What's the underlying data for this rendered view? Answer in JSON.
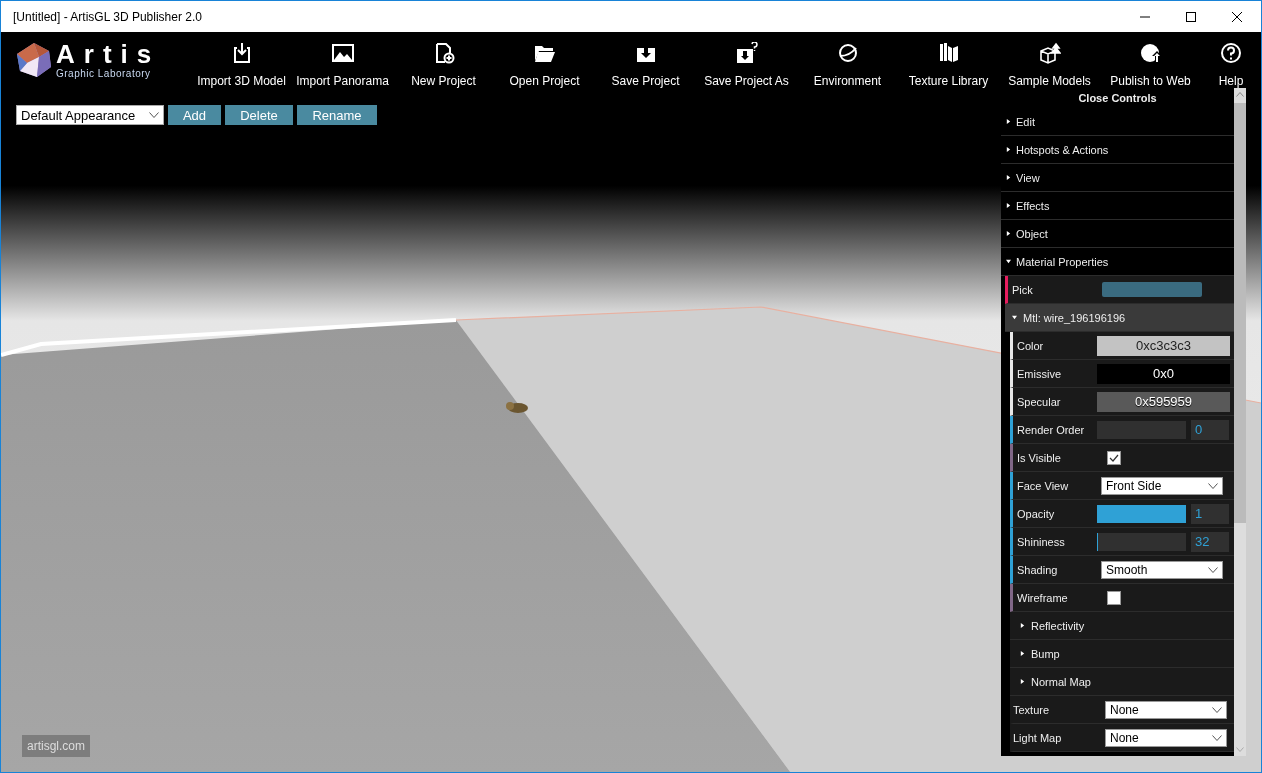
{
  "window": {
    "title": "[Untitled] - ArtisGL 3D Publisher 2.0"
  },
  "logo": {
    "name": "Artis",
    "subtitle": "Graphic Laboratory"
  },
  "toolbar": {
    "items": [
      {
        "label": "Import 3D Model"
      },
      {
        "label": "Import Panorama"
      },
      {
        "label": "New Project"
      },
      {
        "label": "Open Project"
      },
      {
        "label": "Save Project"
      },
      {
        "label": "Save Project As"
      },
      {
        "label": "Environment"
      },
      {
        "label": "Texture Library"
      },
      {
        "label": "Sample Models"
      },
      {
        "label": "Publish to Web"
      },
      {
        "label": "Help"
      }
    ]
  },
  "appearance": {
    "value": "Default Appearance",
    "buttons": [
      "Add",
      "Delete",
      "Rename"
    ]
  },
  "viewport": {
    "watermark": "artisgl.com"
  },
  "panel": {
    "close_label": "Close Controls",
    "sections": [
      {
        "label": "Edit",
        "expanded": false
      },
      {
        "label": "Hotspots & Actions",
        "expanded": false
      },
      {
        "label": "View",
        "expanded": false
      },
      {
        "label": "Effects",
        "expanded": false
      },
      {
        "label": "Object",
        "expanded": false
      },
      {
        "label": "Material Properties",
        "expanded": true
      }
    ],
    "rows": [
      {
        "kind": "pick",
        "label": "Pick"
      },
      {
        "kind": "folder",
        "label": "Mtl: wire_196196196",
        "expanded": true
      },
      {
        "kind": "color",
        "label": "Color",
        "value": "0xc3c3c3",
        "color": "#c3c3c3"
      },
      {
        "kind": "color",
        "label": "Emissive",
        "value": "0x0",
        "color": "#000000"
      },
      {
        "kind": "color",
        "label": "Specular",
        "value": "0x595959",
        "color": "#595959"
      },
      {
        "kind": "number",
        "label": "Render Order",
        "value": "0"
      },
      {
        "kind": "checkbox",
        "label": "Is Visible",
        "checked": true
      },
      {
        "kind": "select",
        "label": "Face View",
        "value": "Front Side"
      },
      {
        "kind": "slider",
        "label": "Opacity",
        "value": "1",
        "level": 1
      },
      {
        "kind": "slider",
        "label": "Shininess",
        "value": "32",
        "level": 0.01
      },
      {
        "kind": "select",
        "label": "Shading",
        "value": "Smooth"
      },
      {
        "kind": "checkbox",
        "label": "Wireframe",
        "checked": false
      },
      {
        "kind": "subfolder",
        "label": "Reflectivity",
        "expanded": false
      },
      {
        "kind": "subfolder",
        "label": "Bump",
        "expanded": false
      },
      {
        "kind": "subfolder",
        "label": "Normal Map",
        "expanded": false
      },
      {
        "kind": "plainselect",
        "label": "Texture",
        "value": "None"
      },
      {
        "kind": "plainselect",
        "label": "Light Map",
        "value": "None"
      }
    ]
  }
}
